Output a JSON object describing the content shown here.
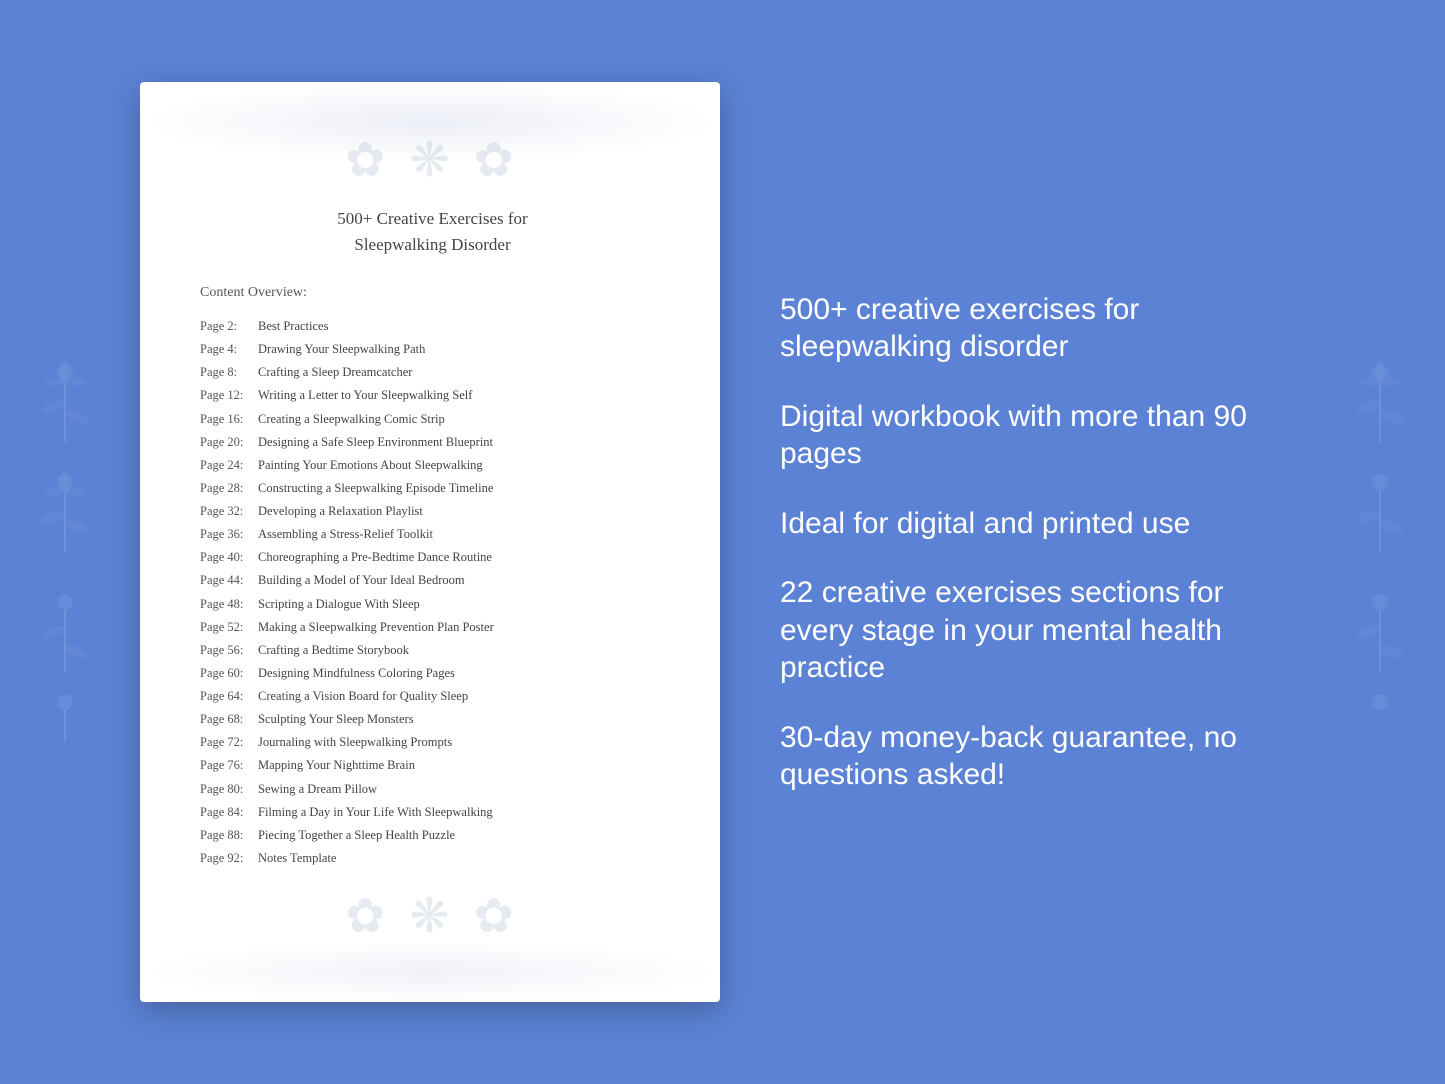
{
  "document": {
    "title_line1": "500+ Creative Exercises for",
    "title_line2": "Sleepwalking Disorder",
    "content_overview_label": "Content Overview:",
    "toc_items": [
      {
        "page": "Page  2:",
        "entry": "Best Practices"
      },
      {
        "page": "Page  4:",
        "entry": "Drawing Your Sleepwalking Path"
      },
      {
        "page": "Page  8:",
        "entry": "Crafting a Sleep Dreamcatcher"
      },
      {
        "page": "Page 12:",
        "entry": "Writing a Letter to Your Sleepwalking Self"
      },
      {
        "page": "Page 16:",
        "entry": "Creating a Sleepwalking Comic Strip"
      },
      {
        "page": "Page 20:",
        "entry": "Designing a Safe Sleep Environment Blueprint"
      },
      {
        "page": "Page 24:",
        "entry": "Painting Your Emotions About Sleepwalking"
      },
      {
        "page": "Page 28:",
        "entry": "Constructing a Sleepwalking Episode Timeline"
      },
      {
        "page": "Page 32:",
        "entry": "Developing a Relaxation Playlist"
      },
      {
        "page": "Page 36:",
        "entry": "Assembling a Stress-Relief Toolkit"
      },
      {
        "page": "Page 40:",
        "entry": "Choreographing a Pre-Bedtime Dance Routine"
      },
      {
        "page": "Page 44:",
        "entry": "Building a Model of Your Ideal Bedroom"
      },
      {
        "page": "Page 48:",
        "entry": "Scripting a Dialogue With Sleep"
      },
      {
        "page": "Page 52:",
        "entry": "Making a Sleepwalking Prevention Plan Poster"
      },
      {
        "page": "Page 56:",
        "entry": "Crafting a Bedtime Storybook"
      },
      {
        "page": "Page 60:",
        "entry": "Designing Mindfulness Coloring Pages"
      },
      {
        "page": "Page 64:",
        "entry": "Creating a Vision Board for Quality Sleep"
      },
      {
        "page": "Page 68:",
        "entry": "Sculpting Your Sleep Monsters"
      },
      {
        "page": "Page 72:",
        "entry": "Journaling with Sleepwalking Prompts"
      },
      {
        "page": "Page 76:",
        "entry": "Mapping Your Nighttime Brain"
      },
      {
        "page": "Page 80:",
        "entry": "Sewing a Dream Pillow"
      },
      {
        "page": "Page 84:",
        "entry": "Filming a Day in Your Life With Sleepwalking"
      },
      {
        "page": "Page 88:",
        "entry": "Piecing Together a Sleep Health Puzzle"
      },
      {
        "page": "Page 92:",
        "entry": "Notes Template"
      }
    ]
  },
  "marketing": {
    "points": [
      "500+ creative exercises for sleepwalking disorder",
      "Digital workbook with more than 90 pages",
      "Ideal for digital and printed use",
      "22 creative exercises sections for every stage in your mental health practice",
      "30-day money-back guarantee, no questions asked!"
    ]
  }
}
